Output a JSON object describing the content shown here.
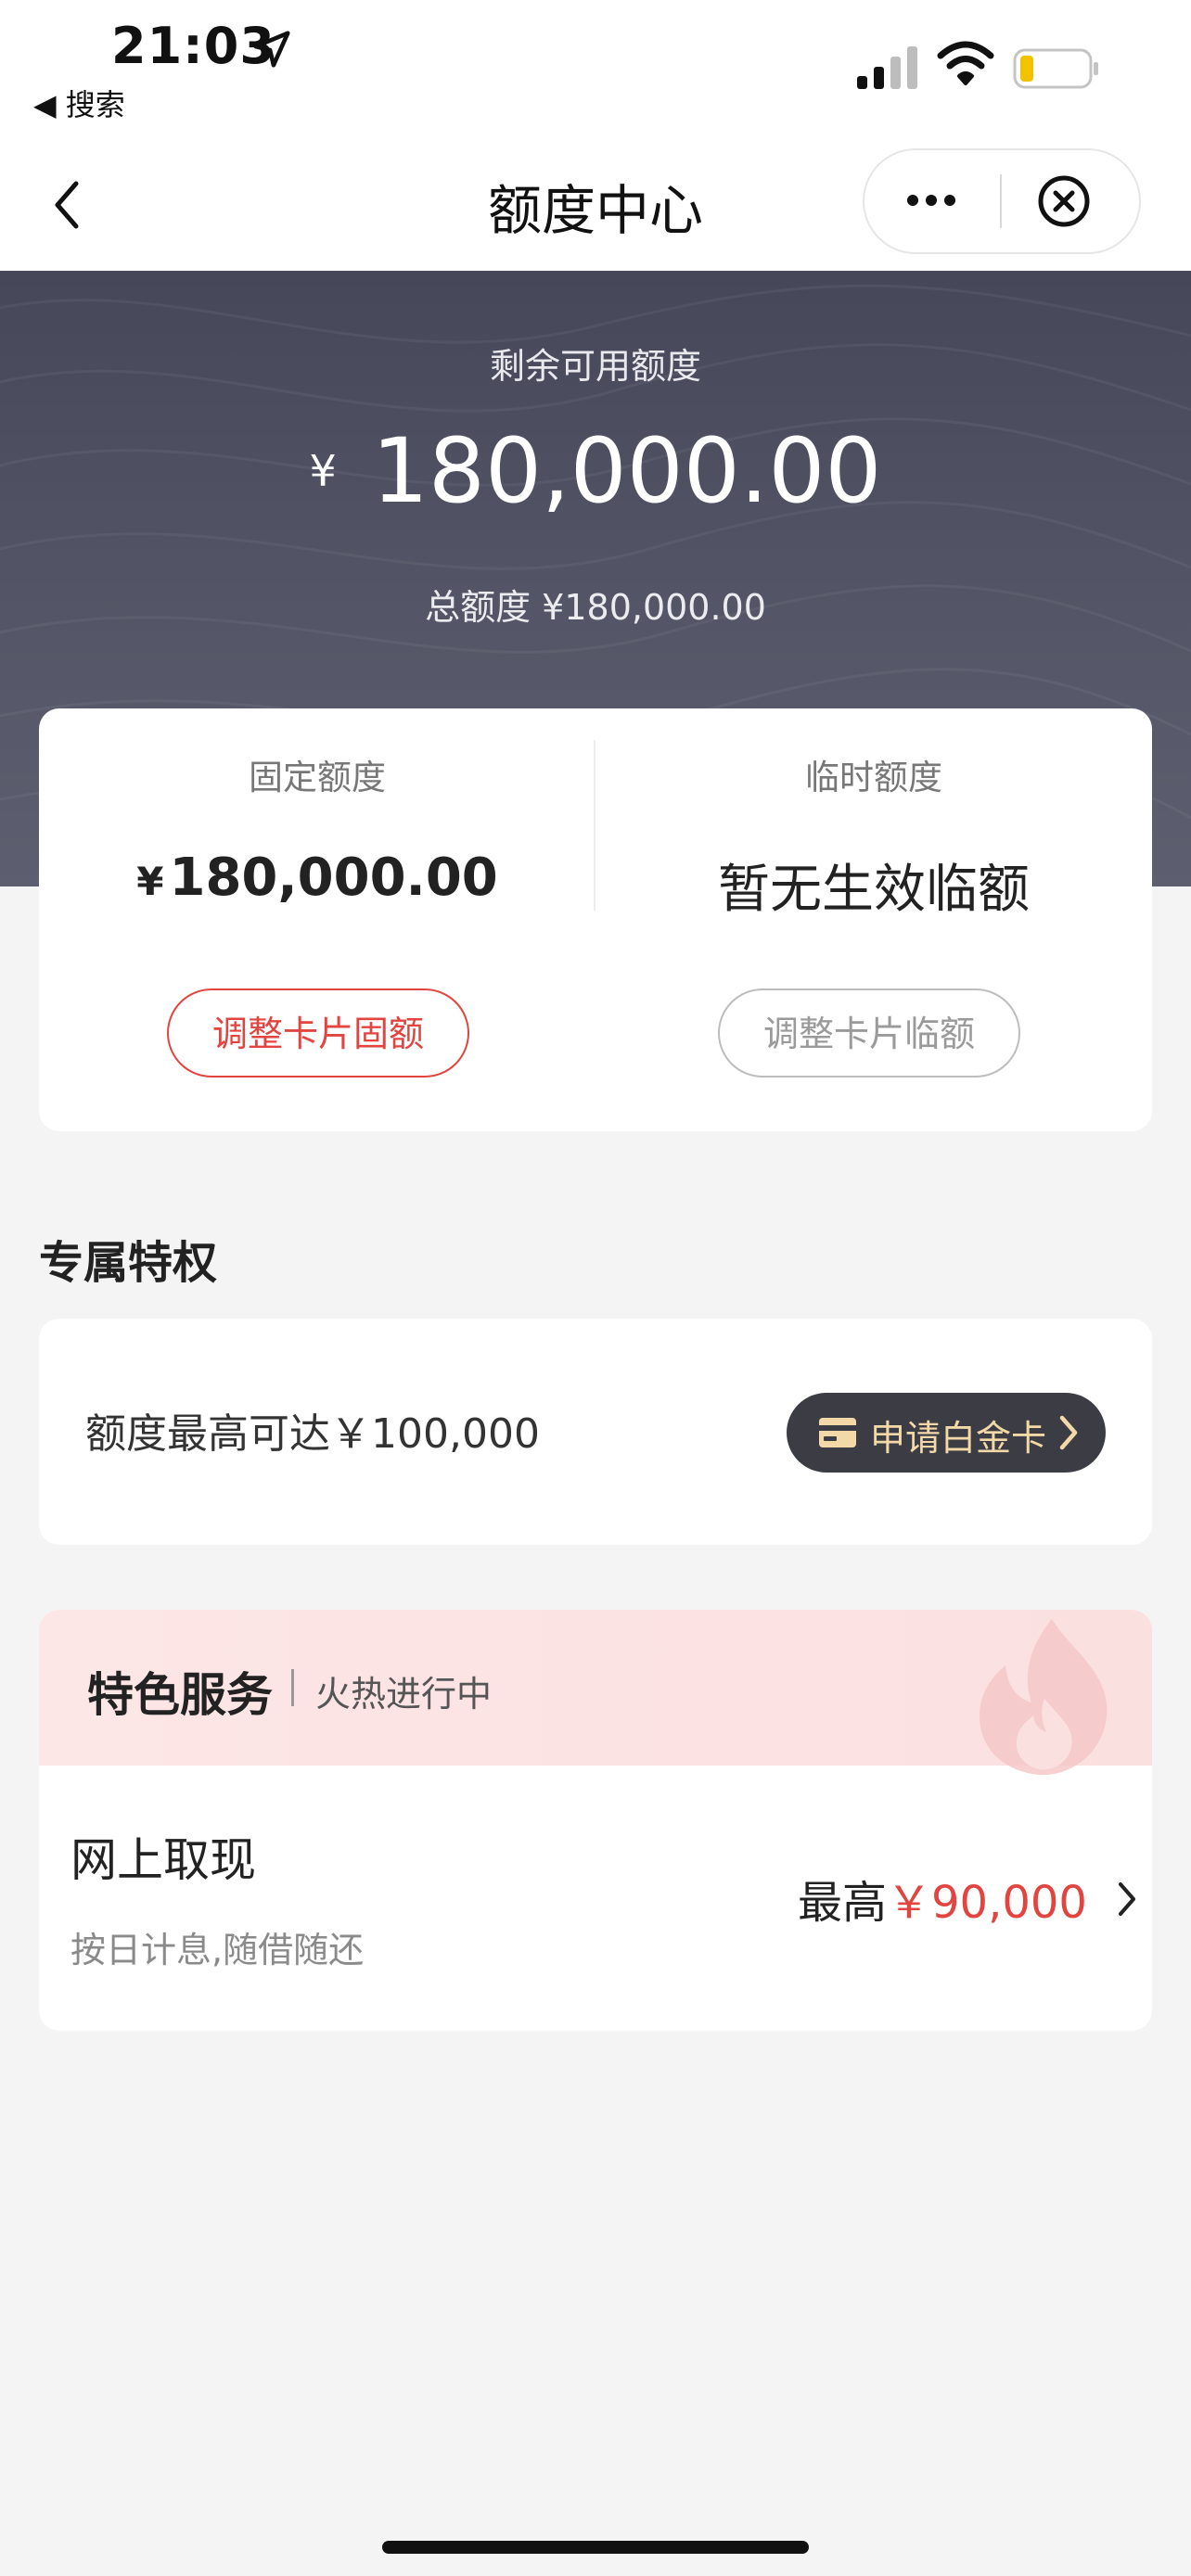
{
  "status_bar": {
    "time": "21:03",
    "back_label": "◀ 搜索"
  },
  "nav": {
    "title": "额度中心"
  },
  "hero": {
    "label": "剩余可用额度",
    "currency": "¥",
    "available": "180,000.00",
    "total_text": "总额度 ¥180,000.00"
  },
  "limits": {
    "fixed": {
      "title": "固定额度",
      "currency": "¥",
      "amount": "180,000.00",
      "button": "调整卡片固额"
    },
    "temp": {
      "title": "临时额度",
      "status": "暂无生效临额",
      "button": "调整卡片临额"
    }
  },
  "privilege": {
    "section_title": "专属特权",
    "text": "额度最高可达￥100,000",
    "button": "申请白金卡"
  },
  "service": {
    "title": "特色服务",
    "subtitle": "火热进行中",
    "item": {
      "title": "网上取现",
      "desc": "按日计息,随借随还",
      "prefix": "最高",
      "amount": "￥90,000"
    }
  },
  "colors": {
    "accent": "#e2443f",
    "hero_bg": "#4f5163",
    "gold": "#f3d9a8"
  },
  "icons": [
    "location-arrow-icon",
    "signal-icon",
    "wifi-icon",
    "battery-icon",
    "back-chevron-icon",
    "more-icon",
    "close-icon",
    "card-icon",
    "chevron-right-icon",
    "flame-icon"
  ]
}
